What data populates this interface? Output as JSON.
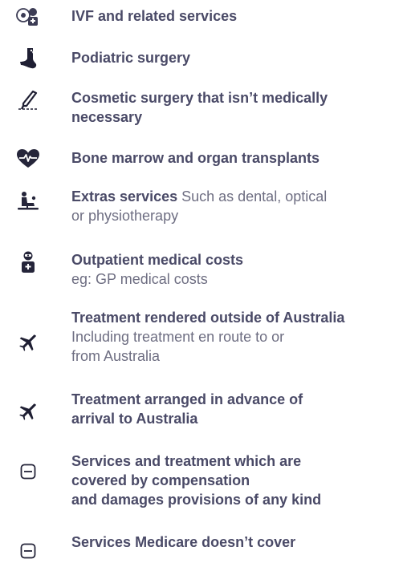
{
  "exclusions": {
    "items": [
      {
        "icon": "ivf-icon",
        "title_lines": [
          "IVF and related services"
        ],
        "desc_lines": []
      },
      {
        "icon": "foot-icon",
        "title_lines": [
          "Podiatric surgery"
        ],
        "desc_lines": []
      },
      {
        "icon": "scalpel-icon",
        "title_lines": [
          "Cosmetic surgery that isn’t medically",
          "necessary"
        ],
        "desc_lines": []
      },
      {
        "icon": "heart-pulse-icon",
        "title_lines": [
          "Bone marrow and organ transplants"
        ],
        "desc_lines": []
      },
      {
        "icon": "dental-chair-icon",
        "title_inline": "Extras services",
        "inline_desc": " Such as dental, optical",
        "desc_lines": [
          "or physiotherapy"
        ]
      },
      {
        "icon": "doctor-icon",
        "title_lines": [
          "Outpatient medical costs"
        ],
        "desc_lines": [
          "eg: GP medical costs"
        ]
      },
      {
        "icon": "airplane-icon",
        "title_lines": [
          "Treatment rendered outside of Australia"
        ],
        "desc_lines": [
          "Including treatment en route to or",
          "from Australia"
        ]
      },
      {
        "icon": "airplane-icon",
        "title_lines": [
          "Treatment arranged in advance of",
          "arrival to Australia"
        ],
        "desc_lines": []
      },
      {
        "icon": "minus-box-icon",
        "title_lines": [
          "Services and treatment which are",
          "covered by compensation",
          "and damages provisions of any kind"
        ],
        "desc_lines": []
      },
      {
        "icon": "minus-box-icon",
        "title_lines": [
          "Services Medicare doesn’t cover"
        ],
        "desc_lines": []
      }
    ]
  }
}
